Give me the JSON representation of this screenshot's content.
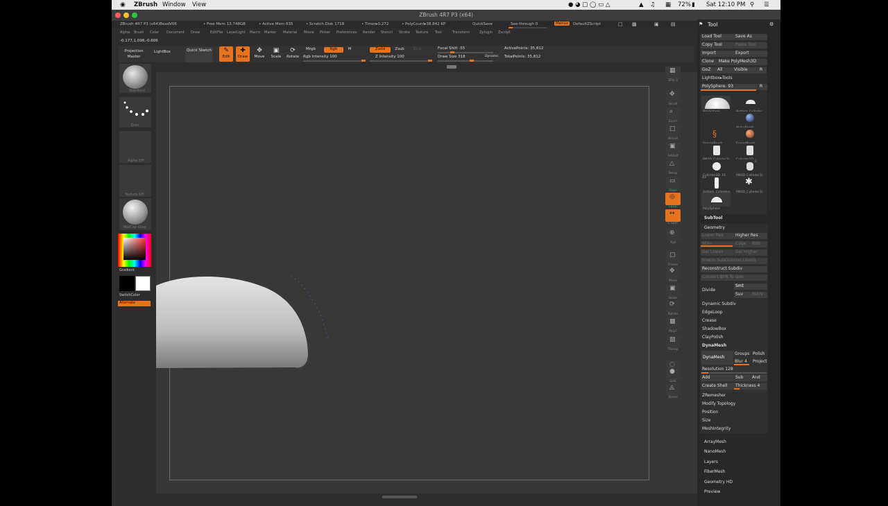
{
  "mac_menubar": {
    "apple": "",
    "app_name": "ZBrush",
    "menus": [
      "Window",
      "View"
    ],
    "battery": "72%",
    "clock": "Sat 12:10 PM"
  },
  "window": {
    "title": "ZBrush 4R7 P3 (x64)"
  },
  "info_bar": {
    "app_version": "ZBrush 4R7 P3 (x64)BeadV06",
    "free_mem": "• Free Mem 13.748GB",
    "active_mem": "• Active Mem 635",
    "scratch_disk": "• Scratch Disk 1718",
    "timer": "• Timer▸0.272",
    "poly_count": "• PolyCount▸38.842 KP",
    "quicksave": "QuickSave",
    "see_through": "See-through  0",
    "menus_btn": "Menus",
    "default_zscript": "DefaultZScript"
  },
  "menu_row": [
    "Alpha",
    "Brush",
    "Color",
    "Document",
    "Draw",
    "Edit",
    "File",
    "Layer",
    "Light",
    "Macro",
    "Marker",
    "Material",
    "Movie",
    "Picker",
    "Preferences",
    "Render",
    "Stencil",
    "Stroke",
    "Texture",
    "Tool",
    "Transform",
    "Zplugin",
    "Zscript"
  ],
  "coords": "-0.177,1.098,-0.606",
  "toolbar": {
    "projection_master": "Projection Master",
    "lightbox": "LightBox",
    "quick_sketch": "Quick Sketch",
    "edit": "Edit",
    "draw": "Draw",
    "move": "Move",
    "scale": "Scale",
    "rotate": "Rotate",
    "mrgb": "Mrgb",
    "rgb": "Rgb",
    "m": "M",
    "zadd": "Zadd",
    "zsub": "Zsub",
    "zcut": "Zcut",
    "rgb_intensity": "Rgb Intensity 100",
    "z_intensity": "Z Intensity 100",
    "focal_shift": "Focal Shift -55",
    "draw_size": "Draw Size 318",
    "dynamic": "Dynamic",
    "active_points": "ActivePoints: 35,812",
    "total_points": "TotalPoints: 35,812"
  },
  "left_shelf": {
    "brush_label": "Standard",
    "stroke_label": "Dots",
    "alpha_label": "Alpha Off",
    "texture_label": "Texture Off",
    "material_label": "MatCap Gray",
    "gradient": "Gradient",
    "switch_color": "SwitchColor",
    "alternate": "Alternate"
  },
  "right_shelf": [
    "SPix 3",
    "Scroll",
    "Zoom",
    "Actual",
    "AAHalf",
    "Persp",
    "Floor",
    "Local",
    "L.Sym",
    "Xyz",
    "Frame",
    "Move",
    "Scale",
    "Rotate",
    "PolyF",
    "Transp",
    "Ghost",
    "Solo",
    "Xpose"
  ],
  "tool_panel": {
    "title": "Tool",
    "load_tool": "Load Tool",
    "save_as": "Save As",
    "copy_tool": "Copy Tool",
    "paste_tool": "Paste Tool",
    "import": "Import",
    "export": "Export",
    "clone": "Clone",
    "make_polymesh": "Make PolyMesh3D",
    "goz": "GoZ",
    "all": "All",
    "visible": "Visible",
    "r": "R",
    "lightbox_tools": "Lightbox▸Tools",
    "current_tool": "PolySphere. 93",
    "thumbs": [
      "PolySphere",
      "Bottom_Cylinder",
      "",
      "AlphaBrush",
      "SimpleBrush",
      "EraserBrush",
      "PM3D_Cylinder3I",
      "Cylinder3D",
      "Cylinder3D_16",
      "PM3D_Cylinder3I",
      "Bottom_Cylinders",
      "PM3D_Cylinder3I",
      "PolySphere"
    ],
    "thumb_badges": [
      "2",
      "43"
    ],
    "subtool": "SubTool",
    "geometry": "Geometry",
    "lower_res": "Lower Res",
    "higher_res": "Higher Res",
    "sdiv": "SDiv",
    "cage": "Cage",
    "rstr": "Rstr",
    "del_lower": "Del Lower",
    "del_higher": "Del Higher",
    "freeze_subdiv": "Freeze SubDivision Levels",
    "reconstruct_subdiv": "Reconstruct Subdiv",
    "convert_bpr": "Convert BPR To Geo",
    "divide": "Divide",
    "smt": "Smt",
    "suv": "Suv",
    "reuv": "ReUV",
    "dynamic_subdiv": "Dynamic Subdiv",
    "edgeloop": "EdgeLoop",
    "crease": "Crease",
    "shadowbox": "ShadowBox",
    "claypolish": "ClayPolish",
    "dynamesh_head": "DynaMesh",
    "dynamesh_btn": "DynaMesh",
    "groups": "Groups",
    "polish": "Polish",
    "blur": "Blur 4",
    "project": "Project",
    "resolution": "Resolution 128",
    "add": "Add",
    "sub": "Sub",
    "and": "And",
    "create_shell": "Create Shell",
    "thickness": "Thickness 4",
    "zremesher": "ZRemesher",
    "modify_topology": "Modify Topology",
    "position": "Position",
    "size": "Size",
    "mesh_integrity": "MeshIntegrity",
    "array_mesh": "ArrayMesh",
    "nano_mesh": "NanoMesh",
    "layers": "Layers",
    "fiber_mesh": "FiberMesh",
    "geometry_hd": "Geometry HD",
    "preview": "Preview"
  },
  "colors": {
    "accent": "#e8731e",
    "panel": "#282828",
    "canvas": "#383838"
  }
}
